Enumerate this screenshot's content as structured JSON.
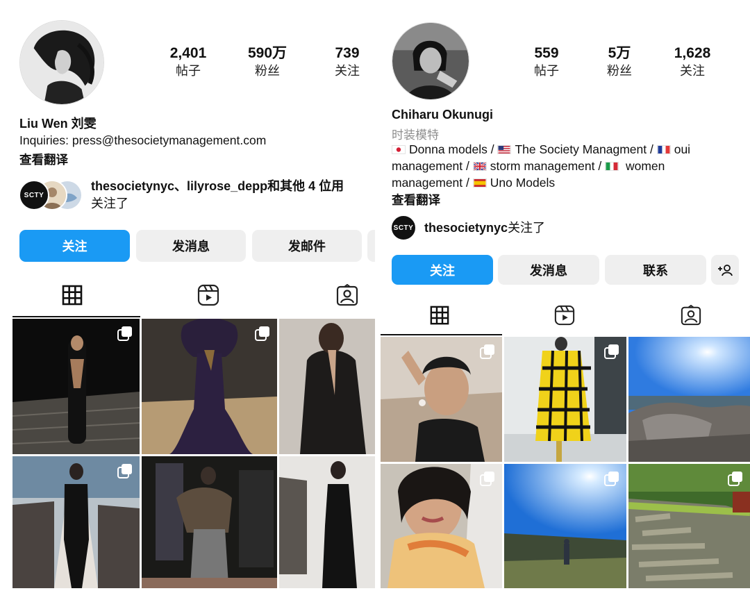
{
  "left": {
    "username": "Liu Wen 刘雯",
    "stats": [
      {
        "value": "2,401",
        "label": "帖子"
      },
      {
        "value": "590万",
        "label": "粉丝"
      },
      {
        "value": "739",
        "label": "关注"
      }
    ],
    "bio": [
      "Inquiries: press@thesocietymanagement.com"
    ],
    "see_translation": "查看翻译",
    "followed_by": {
      "badge": "SCTY",
      "users": "thesocietynyc、lilyrose_depp",
      "suffix": "和其他 4 位用",
      "line2": "关注了"
    },
    "buttons": {
      "follow": "关注",
      "message": "发消息",
      "email": "发邮件"
    },
    "tabs": [
      "grid-icon",
      "reels-icon",
      "tagged-icon"
    ],
    "grid": [
      {
        "desc": "runway-black-cutout-dress",
        "multi": true
      },
      {
        "desc": "runway-purple-gown",
        "multi": true
      },
      {
        "desc": "black-leather-coat",
        "multi": false
      },
      {
        "desc": "runway-black-suit",
        "multi": true
      },
      {
        "desc": "runway-houndstooth-skirt",
        "multi": false
      },
      {
        "desc": "runway-black-dress",
        "multi": false
      }
    ]
  },
  "right": {
    "username": "Chiharu Okunugi",
    "category": "时装模特",
    "stats": [
      {
        "value": "559",
        "label": "帖子"
      },
      {
        "value": "5万",
        "label": "粉丝"
      },
      {
        "value": "1,628",
        "label": "关注"
      }
    ],
    "bio": {
      "seg1": "Donna models / ",
      "seg2": "The Society Managment / ",
      "seg3": "oui",
      "seg4": "management / ",
      "seg5": "storm management / ",
      "seg6": " women",
      "seg7": "management / ",
      "seg8": "Uno Models"
    },
    "see_translation": "查看翻译",
    "followed_by": {
      "badge": "SCTY",
      "user": "thesocietynyc",
      "suffix": "关注了"
    },
    "buttons": {
      "follow": "关注",
      "message": "发消息",
      "contact": "联系"
    },
    "tabs": [
      "grid-icon",
      "reels-icon",
      "tagged-icon"
    ],
    "grid": [
      {
        "desc": "portrait-hands-on-head",
        "multi": true
      },
      {
        "desc": "yellow-plaid-coat-runway",
        "multi": true
      },
      {
        "desc": "sunny-rocky-overlook",
        "multi": false
      },
      {
        "desc": "selfie-with-scarf",
        "multi": true
      },
      {
        "desc": "sunny-hillside-person",
        "multi": true
      },
      {
        "desc": "mossy-stone-wall",
        "multi": true
      }
    ]
  },
  "colors": {
    "primary_button": "#1a9af4",
    "secondary_button": "#efefef",
    "muted_text": "#8e8e8e"
  }
}
